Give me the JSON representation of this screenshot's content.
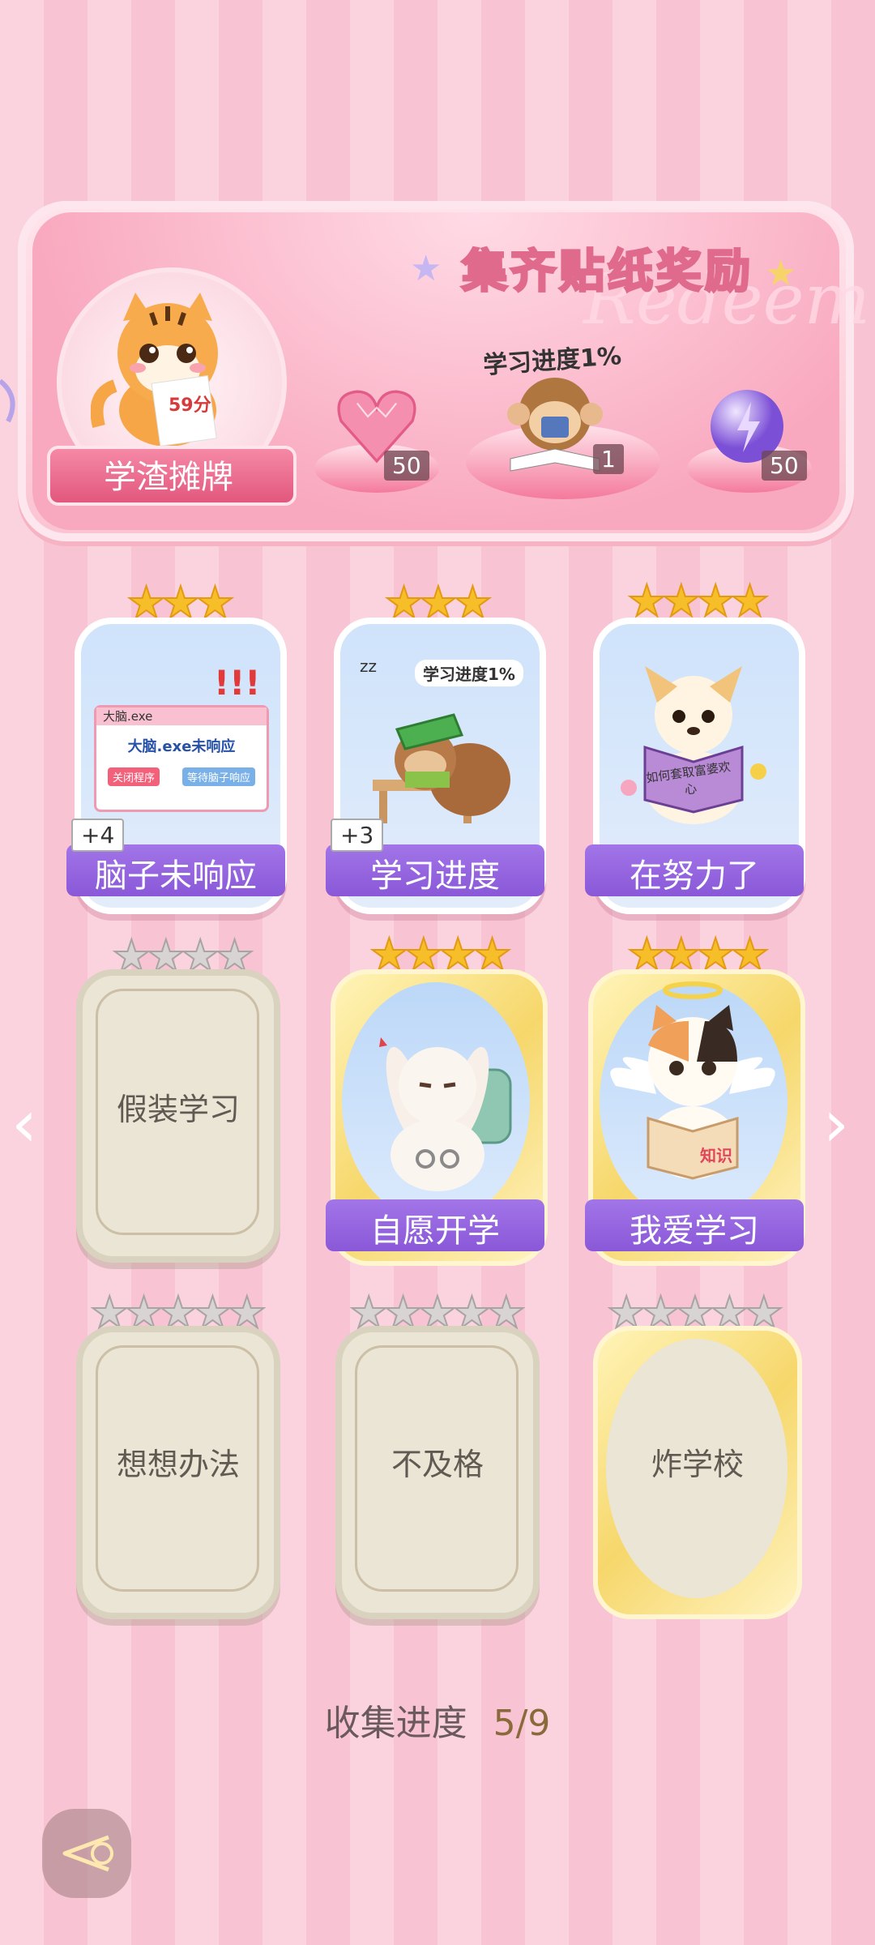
{
  "banner": {
    "title": "集齐贴纸奖励",
    "watermark": "Redeem",
    "avatar_label": "学渣摊牌",
    "avatar_sign": "59分",
    "progress_text": "学习进度1%",
    "rewards": [
      {
        "icon": "heart-gem-icon",
        "count": "50"
      },
      {
        "icon": "monkey-study-icon",
        "count": "1"
      },
      {
        "icon": "lightning-orb-icon",
        "count": "50"
      }
    ]
  },
  "cards": [
    {
      "name": "脑子未响应",
      "stars": 3,
      "max_stars": 3,
      "state": "owned",
      "extra": "+4",
      "art": {
        "window_title": "大脑.exe",
        "message": "大脑.exe未响应",
        "btn1": "关闭程序",
        "btn2": "等待脑子响应"
      }
    },
    {
      "name": "学习进度",
      "stars": 3,
      "max_stars": 3,
      "state": "owned",
      "extra": "+3",
      "art": {
        "caption": "学习进度1%",
        "zz": "zz"
      }
    },
    {
      "name": "在努力了",
      "stars": 4,
      "max_stars": 4,
      "state": "owned",
      "art": {
        "book_text": "如何套取富婆欢心"
      }
    },
    {
      "name": "假装学习",
      "stars": 0,
      "max_stars": 4,
      "state": "locked"
    },
    {
      "name": "自愿开学",
      "stars": 4,
      "max_stars": 4,
      "state": "owned-gold"
    },
    {
      "name": "我爱学习",
      "stars": 4,
      "max_stars": 4,
      "state": "owned-gold",
      "art": {
        "book_text": "知识"
      }
    },
    {
      "name": "想想办法",
      "stars": 0,
      "max_stars": 5,
      "state": "locked"
    },
    {
      "name": "不及格",
      "stars": 0,
      "max_stars": 5,
      "state": "locked"
    },
    {
      "name": "炸学校",
      "stars": 0,
      "max_stars": 5,
      "state": "locked-gold"
    }
  ],
  "footer": {
    "progress_label": "收集进度",
    "progress_value": "5/9"
  },
  "colors": {
    "accent_purple": "#8a58d8",
    "gold_star": "#f6bf2a",
    "pink_bg": "#fbd3df"
  }
}
